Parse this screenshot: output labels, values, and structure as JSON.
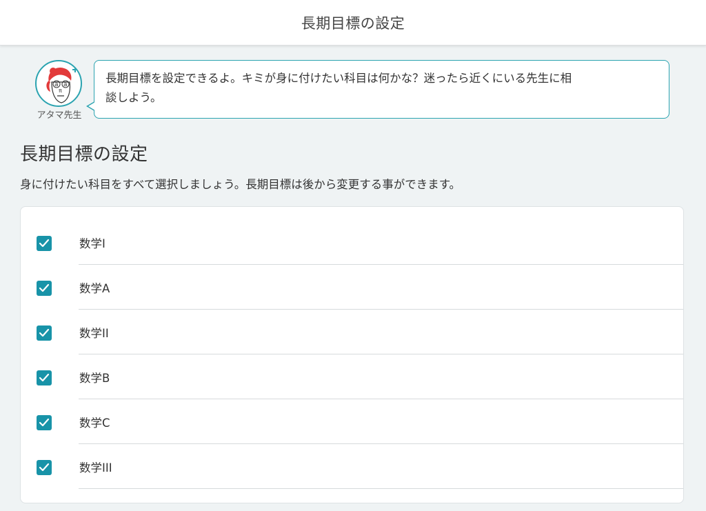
{
  "header": {
    "title": "長期目標の設定"
  },
  "mascot": {
    "name": "アタマ先生",
    "icon": "atama-sensei-avatar-icon"
  },
  "speech": {
    "text_line1": "長期目標を設定できるよ。キミが身に付けたい科目は何かな？迷ったら近くにいる先生に相",
    "text_line2": "談しよう。"
  },
  "main": {
    "title": "長期目標の設定",
    "description": "身に付けたい科目をすべて選択しましょう。長期目標は後から変更する事ができます。"
  },
  "subjects": [
    {
      "label": "数学I",
      "checked": true
    },
    {
      "label": "数学A",
      "checked": true
    },
    {
      "label": "数学II",
      "checked": true
    },
    {
      "label": "数学B",
      "checked": true
    },
    {
      "label": "数学C",
      "checked": true
    },
    {
      "label": "数学III",
      "checked": true
    }
  ],
  "colors": {
    "accent": "#1893a8",
    "bubble_border": "#2aa3b0",
    "background": "#eff3f4"
  }
}
